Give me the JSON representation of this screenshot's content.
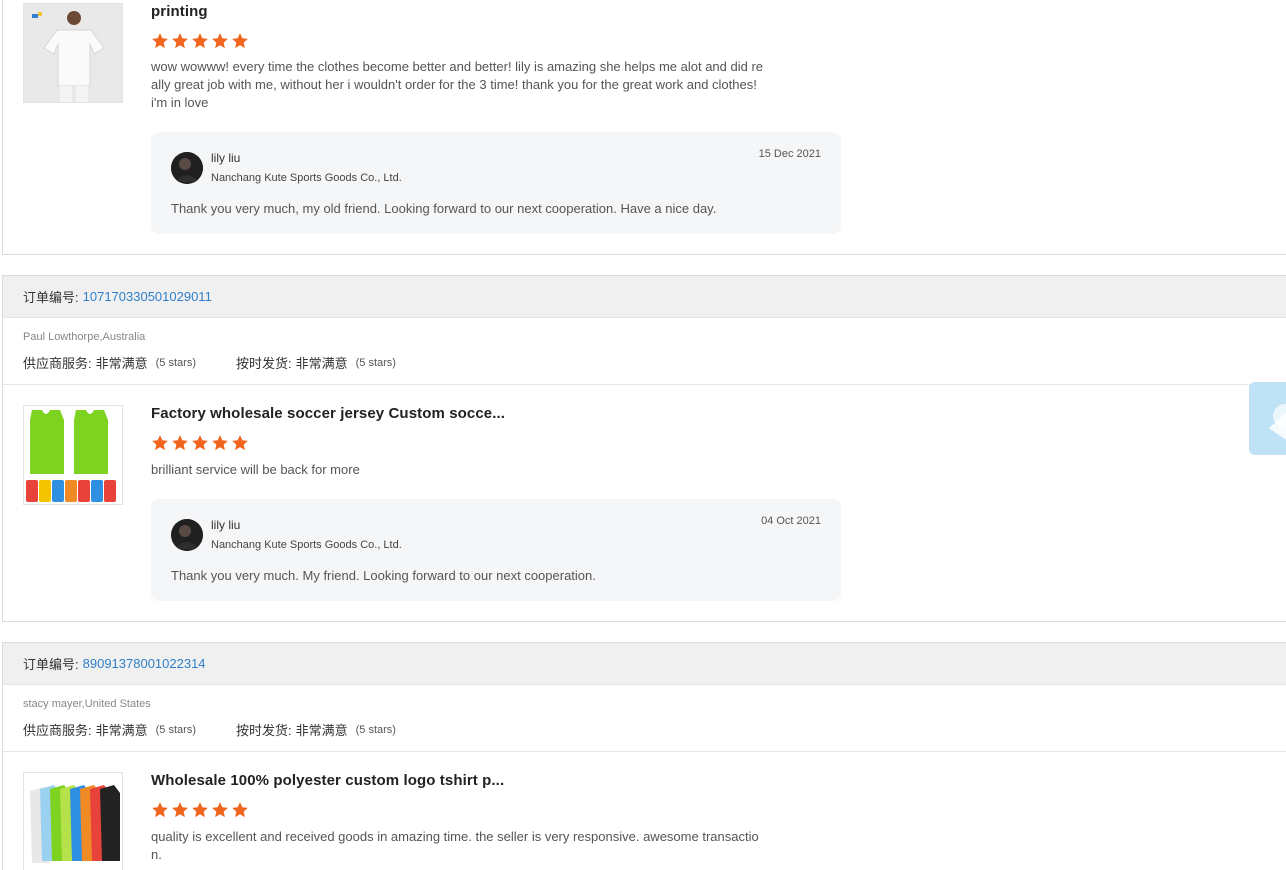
{
  "reviews": [
    {
      "product_title": "printing",
      "rating": 5,
      "comment": "wow wowww! every time the clothes become better and better! lily is amazing she helps me alot and did re\nally great job with me, without her i wouldn't order for the 3 time!  thank you for the great work and clothes!\ni'm in love",
      "thumb_icon": "white-tshirt-model-image",
      "reply": {
        "name": "lily liu",
        "company": "Nanchang Kute Sports Goods Co., Ltd.",
        "date": "15 Dec 2021",
        "text": "Thank you very much, my old friend. Looking forward to our next cooperation. Have a nice day."
      }
    },
    {
      "order_label": "订单编号:",
      "order_number": "107170330501029011",
      "buyer": "Paul Lowthorpe,Australia",
      "supplier_service_label": "供应商服务:",
      "supplier_service_value": "非常满意",
      "supplier_service_stars": "(5 stars)",
      "on_time_label": "按时发货:",
      "on_time_value": "非常满意",
      "on_time_stars": "(5 stars)",
      "product_title": "Factory wholesale soccer jersey Custom socce...",
      "rating": 5,
      "comment": "brilliant service  will be back for more",
      "thumb_icon": "soccer-jersey-image",
      "reply": {
        "name": "lily liu",
        "company": "Nanchang Kute Sports Goods Co., Ltd.",
        "date": "04 Oct 2021",
        "text": "Thank you very much. My friend. Looking forward to our next cooperation."
      }
    },
    {
      "order_label": "订单编号:",
      "order_number": "89091378001022314",
      "buyer": "stacy mayer,United States",
      "supplier_service_label": "供应商服务:",
      "supplier_service_value": "非常满意",
      "supplier_service_stars": "(5 stars)",
      "on_time_label": "按时发货:",
      "on_time_value": "非常满意",
      "on_time_stars": "(5 stars)",
      "product_title": "Wholesale 100% polyester custom logo tshirt p...",
      "rating": 5,
      "comment": "quality is excellent and received goods in amazing time.  the seller is very responsive.  awesome transactio\nn.",
      "thumb_icon": "colorful-tshirts-image"
    }
  ],
  "colors": {
    "star": "#f0661f",
    "link": "#2f7fc8",
    "header_bg": "#f0f0f0",
    "reply_bg": "#f5f6f8",
    "side_widget": "#bfe2f7"
  },
  "icons": {
    "star": "star-icon",
    "avatar": "seller-avatar",
    "side_widget": "chat-widget-icon"
  }
}
